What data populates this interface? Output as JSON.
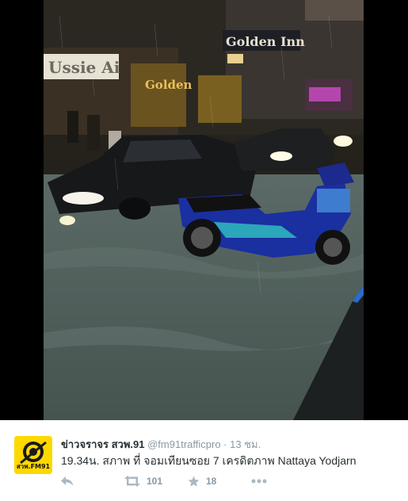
{
  "tweet": {
    "author_name": "ข่าวจราจร สวพ.91",
    "handle": "@fm91trafficpro",
    "separator": "·",
    "time": "13 ชม.",
    "text": "19.34น. สภาพ ที่ จอมเทียนซอย 7 เครดิตภาพ Nattaya Yodjarn",
    "avatar_label": "สวพ.FM91",
    "retweets": "101",
    "favorites": "18"
  },
  "photo": {
    "signs": [
      "Golden Inn",
      "Golden",
      "Ussie Ai"
    ]
  },
  "colors": {
    "avatar_bg": "#ffd800",
    "action_icon": "#aab8c2",
    "handle": "#8899a6",
    "text": "#292f33"
  },
  "icons": [
    "reply-icon",
    "retweet-icon",
    "favorite-star-icon",
    "more-dots-icon"
  ]
}
